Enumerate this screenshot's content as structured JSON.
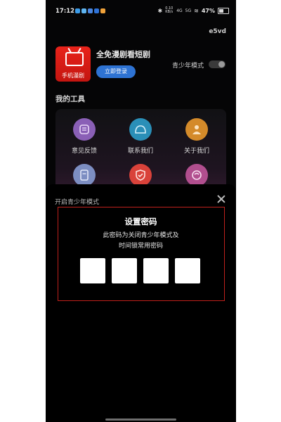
{
  "status_bar": {
    "time": "17:12",
    "network_speed": "0.10 KB/s",
    "signal1": "4G",
    "signal2": "5G",
    "battery": "47%",
    "battery_level": 0.47
  },
  "user_id": "e5vd",
  "app": {
    "logo_text": "手机漫剧",
    "title": "全免漫剧看短剧",
    "login_button": "立即登录",
    "youth_mode_label": "青少年模式",
    "youth_mode_on": false
  },
  "tools": {
    "heading": "我的工具",
    "items": [
      {
        "label": "意见反馈",
        "icon": "feedback-icon",
        "color": "#8a5fb6"
      },
      {
        "label": "联系我们",
        "icon": "chat-bubble-icon",
        "color": "#2a8fb8"
      },
      {
        "label": "关于我们",
        "icon": "about-user-icon",
        "color": "#d48a2a"
      },
      {
        "label": "",
        "icon": "document-icon",
        "color": "#7d8ec2"
      },
      {
        "label": "",
        "icon": "shield-check-icon",
        "color": "#d9423a"
      },
      {
        "label": "",
        "icon": "phone-icon",
        "color": "#b14e8e"
      }
    ]
  },
  "sheet": {
    "title": "开启青少年模式",
    "password_title": "设置密码",
    "password_desc_line1": "此密码为关闭青少年模式及",
    "password_desc_line2": "时间锁常用密码",
    "box_count": 4
  }
}
